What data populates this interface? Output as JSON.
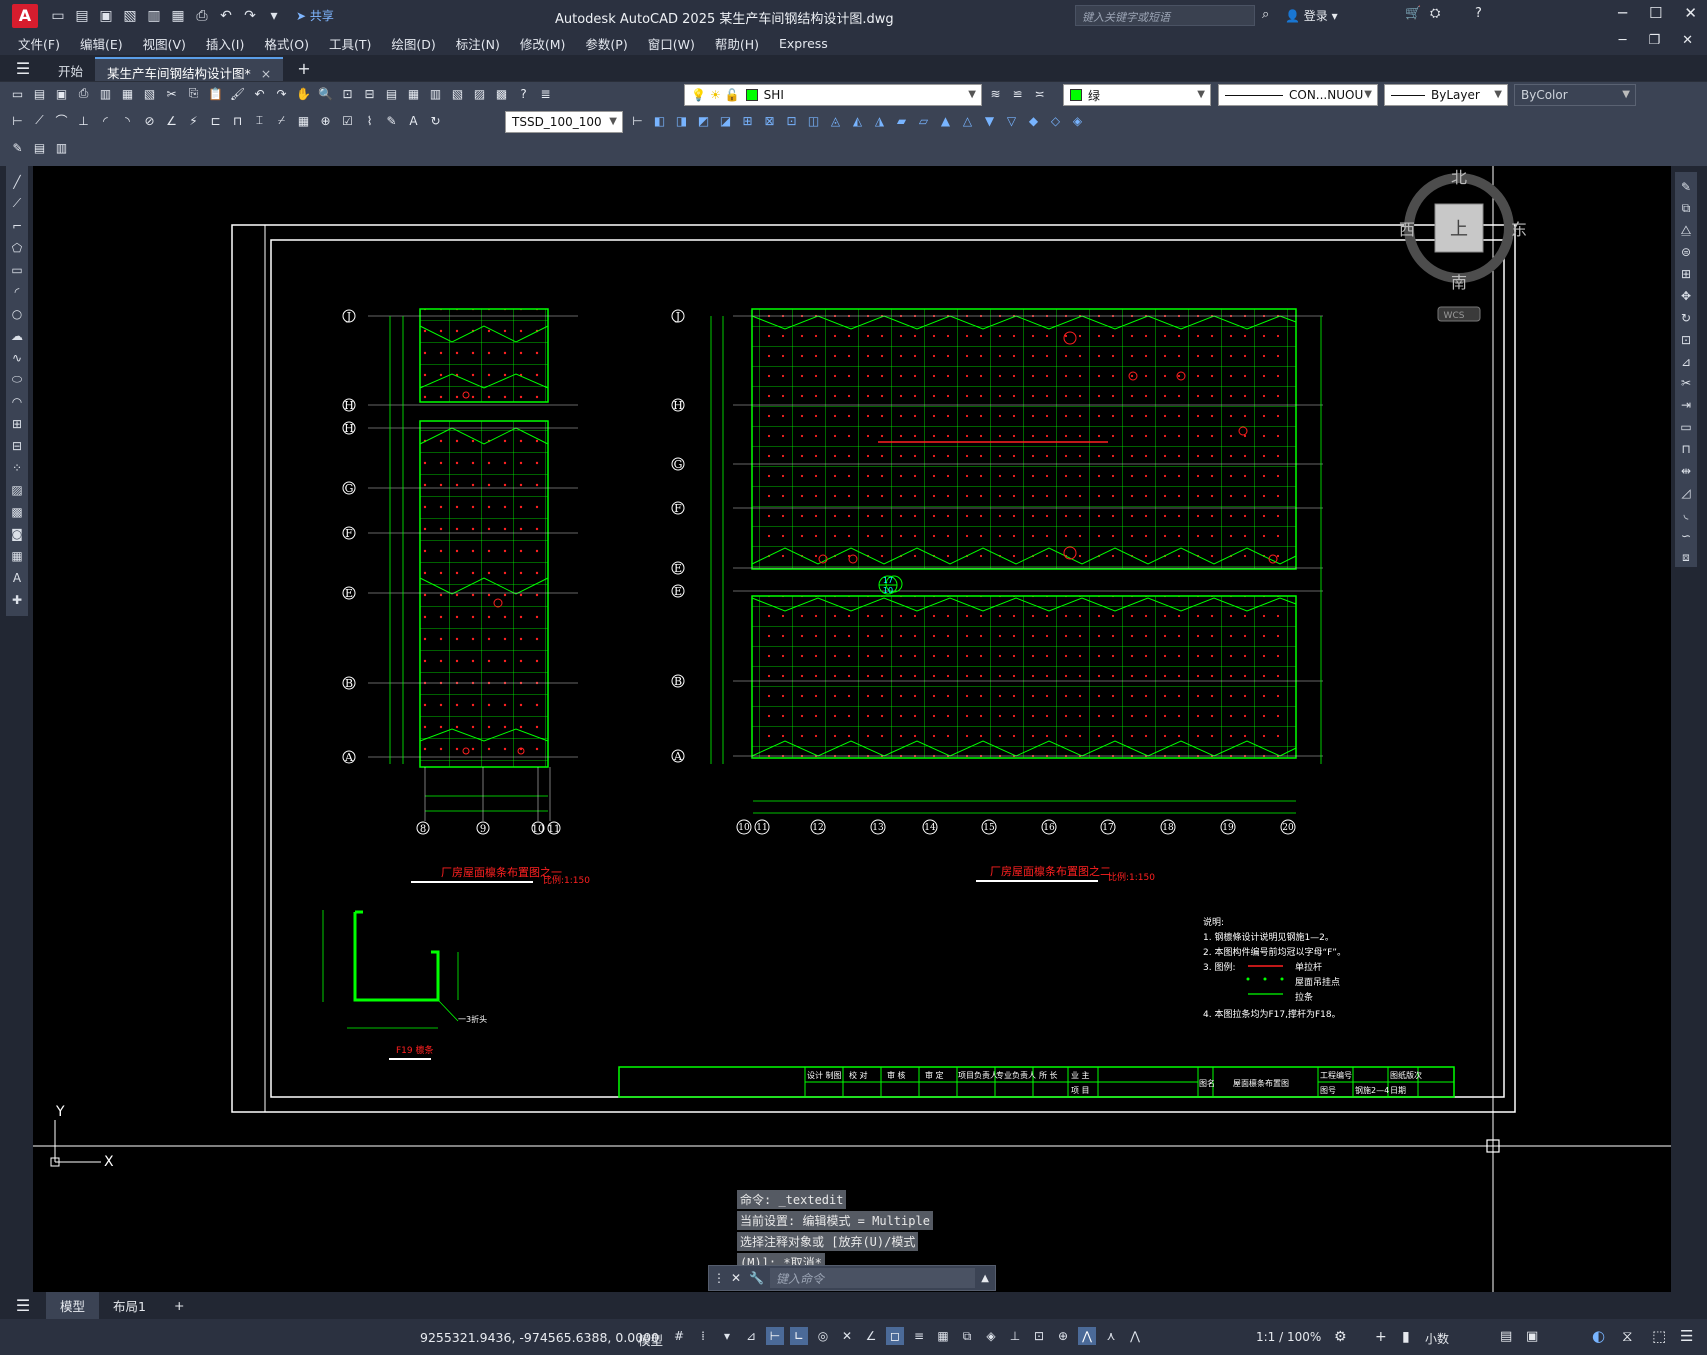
{
  "app": {
    "logo": "A",
    "title": "Autodesk AutoCAD 2025    某生产车间钢结构设计图.dwg",
    "share_label": "共享",
    "search_placeholder": "键入关键字或短语",
    "login_label": "登录"
  },
  "menu": [
    "文件(F)",
    "编辑(E)",
    "视图(V)",
    "插入(I)",
    "格式(O)",
    "工具(T)",
    "绘图(D)",
    "标注(N)",
    "修改(M)",
    "参数(P)",
    "窗口(W)",
    "帮助(H)",
    "Express"
  ],
  "tabs": {
    "start": "开始",
    "drawing": "某生产车间钢结构设计图*",
    "close": "×",
    "new": "+"
  },
  "toolbar": {
    "layer_name": "SHI",
    "color_name": "绿",
    "linetype": "CON...NUOU",
    "lineweight": "ByLayer",
    "plotstyle": "ByColor",
    "dimstyle": "TSSD_100_100"
  },
  "viewcube": {
    "north": "北",
    "south": "南",
    "east": "东",
    "west": "西",
    "top": "上",
    "wcs": "WCS"
  },
  "drawing": {
    "plan1_title": "厂房屋面檩条布置图之一",
    "plan2_title": "厂房屋面檩条布置图之二",
    "scale1": "比例:1:150",
    "scale2": "比例:1:150",
    "detail_title": "F19 檩条",
    "detail_note": "一3折头",
    "axis_left_rows": [
      "J",
      "H",
      "H",
      "G",
      "F",
      "E",
      "B",
      "A"
    ],
    "axis_left_cols": [
      "8",
      "9",
      "10",
      "11"
    ],
    "axis_right_rows": [
      "J",
      "H",
      "G",
      "F",
      "E",
      "E",
      "B",
      "A"
    ],
    "axis_right_cols": [
      "10",
      "11",
      "12",
      "13",
      "14",
      "15",
      "16",
      "17",
      "18",
      "19",
      "20"
    ],
    "callout_top": "17",
    "callout_bottom": "10",
    "notes_title": "说明:",
    "notes": [
      "1. 钢檩條设计说明见钢施1—2。",
      "2. 本图构件编号前均冠以字母“F”。",
      "3. 图例:",
      "4. 本图拉条均为F17,撑杆为F18。"
    ],
    "legend": [
      "单拉杆",
      "屋面吊挂点",
      "拉条"
    ],
    "titleblock": {
      "cells": [
        "设计 制图",
        "校 对",
        "审 核",
        "审 定",
        "项目负责人",
        "专业负责人",
        "所 长",
        "业 主",
        "项 目"
      ],
      "drawing_name_label": "图名",
      "drawing_name": "屋面檩条布置图",
      "project_no_label": "工程编号",
      "sheet_label": "图号",
      "sheet_no": "钢施2—4",
      "version_label": "图纸版次",
      "date_label": "日期"
    }
  },
  "command": {
    "history": [
      "命令: _textedit",
      "当前设置: 编辑模式 = Multiple",
      "选择注释对象或 [放弃(U)/模式",
      "(M)]: *取消*"
    ],
    "placeholder": "键入命令"
  },
  "layout_tabs": [
    "模型",
    "布局1"
  ],
  "status": {
    "coords": "9255321.9436, -974565.6388, 0.0000",
    "space": "模型",
    "scale": "1:1 / 100%",
    "units": "小数"
  },
  "ucs": {
    "x": "X",
    "y": "Y"
  },
  "colors": {
    "drawing_green": "#00ff00",
    "annotation_red": "#ff2020",
    "canvas_bg": "#000000",
    "ui_bg": "#3b4354"
  }
}
